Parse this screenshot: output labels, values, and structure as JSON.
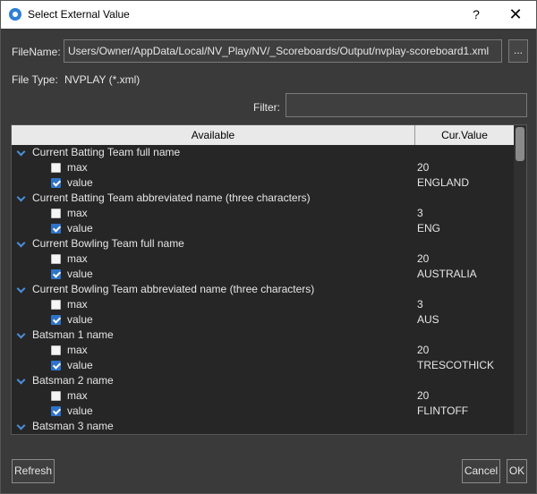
{
  "window": {
    "title": "Select External Value",
    "help_glyph": "?",
    "close_glyph": "✕"
  },
  "file": {
    "name_label": "FileName:",
    "path": "Users/Owner/AppData/Local/NV_Play/NV/_Scoreboards/Output/nvplay-scoreboard1.xml",
    "browse_label": "...",
    "type_label": "File Type:",
    "type_value": "NVPLAY (*.xml)"
  },
  "filter": {
    "label": "Filter:",
    "value": ""
  },
  "tree": {
    "columns": [
      "Available",
      "Cur.Value"
    ],
    "groups": [
      {
        "label": "Current Batting Team full name",
        "items": [
          {
            "label": "max",
            "checked": false,
            "value": "20"
          },
          {
            "label": "value",
            "checked": true,
            "value": "ENGLAND"
          }
        ]
      },
      {
        "label": "Current Batting Team abbreviated name (three characters)",
        "items": [
          {
            "label": "max",
            "checked": false,
            "value": "3"
          },
          {
            "label": "value",
            "checked": true,
            "value": "ENG"
          }
        ]
      },
      {
        "label": "Current Bowling Team full name",
        "items": [
          {
            "label": "max",
            "checked": false,
            "value": "20"
          },
          {
            "label": "value",
            "checked": true,
            "value": "AUSTRALIA"
          }
        ]
      },
      {
        "label": "Current Bowling Team abbreviated name (three characters)",
        "items": [
          {
            "label": "max",
            "checked": false,
            "value": "3"
          },
          {
            "label": "value",
            "checked": true,
            "value": "AUS"
          }
        ]
      },
      {
        "label": "Batsman 1 name",
        "items": [
          {
            "label": "max",
            "checked": false,
            "value": "20"
          },
          {
            "label": "value",
            "checked": true,
            "value": "TRESCOTHICK"
          }
        ]
      },
      {
        "label": "Batsman 2 name",
        "items": [
          {
            "label": "max",
            "checked": false,
            "value": "20"
          },
          {
            "label": "value",
            "checked": true,
            "value": "FLINTOFF"
          }
        ]
      },
      {
        "label": "Batsman 3 name",
        "items": []
      }
    ]
  },
  "buttons": {
    "refresh": "Refresh",
    "cancel": "Cancel",
    "ok": "OK"
  },
  "colors": {
    "accent": "#2f74c8",
    "background": "#3a3a3a",
    "tree_bg": "#262626"
  }
}
